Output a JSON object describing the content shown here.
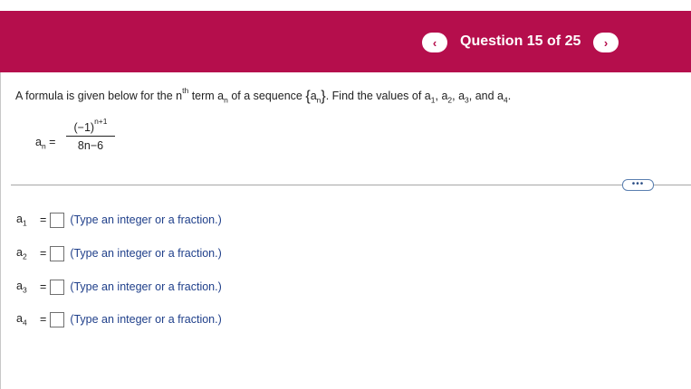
{
  "header": {
    "question_counter": "Question 15 of 25",
    "prev_icon": "chevron-left",
    "next_icon": "chevron-right",
    "prev_glyph": "‹",
    "next_glyph": "›",
    "brand_color": "#b50e4c"
  },
  "prompt": {
    "part1": "A formula is given below for the n",
    "th": "th",
    "part2": " term a",
    "n_sub": "n",
    "part3": " of a sequence ",
    "seq_open": "{",
    "seq_a": "a",
    "seq_n": "n",
    "seq_close": "}",
    "part4": ". Find the values of a",
    "s1": "1",
    "c1": ", a",
    "s2": "2",
    "c2": ", a",
    "s3": "3",
    "c3": ", and a",
    "s4": "4",
    "end": "."
  },
  "formula": {
    "lhs_a": "a",
    "lhs_sub": "n",
    "eq": "=",
    "numerator_base": "(−1)",
    "numerator_exp": "n+1",
    "denominator": "8n−6"
  },
  "more_button": "•••",
  "answers": [
    {
      "label": "a",
      "sub": "1",
      "eq": "=",
      "hint": "(Type an integer or a fraction.)",
      "value": ""
    },
    {
      "label": "a",
      "sub": "2",
      "eq": "=",
      "hint": "(Type an integer or a fraction.)",
      "value": ""
    },
    {
      "label": "a",
      "sub": "3",
      "eq": "=",
      "hint": "(Type an integer or a fraction.)",
      "value": ""
    },
    {
      "label": "a",
      "sub": "4",
      "eq": "=",
      "hint": "(Type an integer or a fraction.)",
      "value": ""
    }
  ]
}
